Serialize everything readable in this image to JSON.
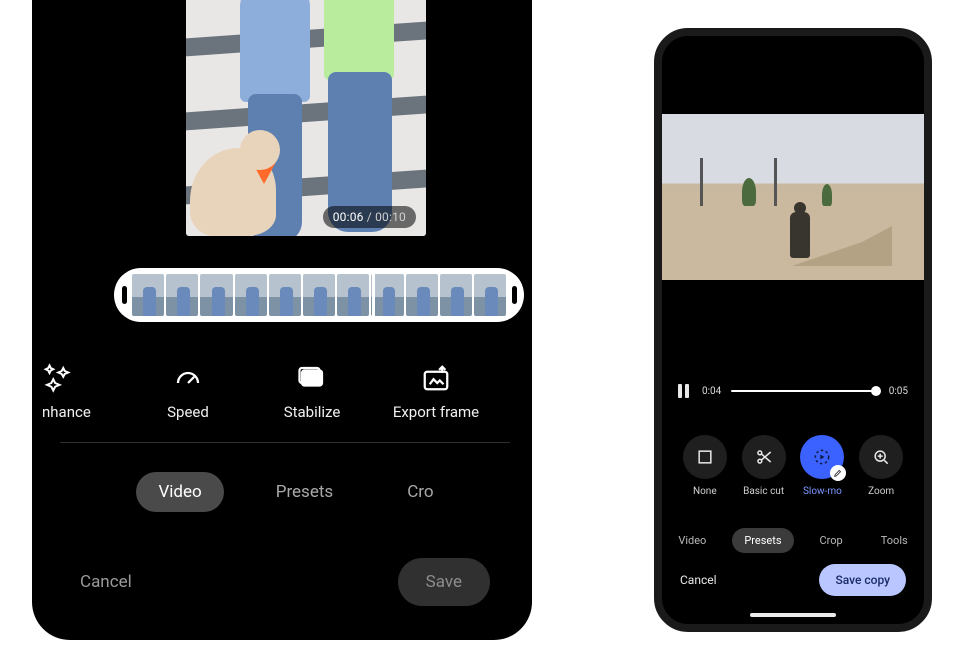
{
  "left": {
    "time": {
      "current": "00:06",
      "sep": " / ",
      "total": "00:10"
    },
    "tools": {
      "enhance": "nhance",
      "speed": "Speed",
      "stabilize": "Stabilize",
      "export_frame": "Export frame"
    },
    "tabs": {
      "video": "Video",
      "presets": "Presets",
      "crop": "Cro"
    },
    "actions": {
      "cancel": "Cancel",
      "save": "Save"
    }
  },
  "right": {
    "progress": {
      "current": "0:04",
      "total": "0:05"
    },
    "presets": {
      "none": "None",
      "basic_cut": "Basic cut",
      "slow_mo": "Slow-mo",
      "zoom": "Zoom"
    },
    "tabs": {
      "video": "Video",
      "presets": "Presets",
      "crop": "Crop",
      "tools": "Tools"
    },
    "actions": {
      "cancel": "Cancel",
      "save_copy": "Save copy"
    }
  }
}
